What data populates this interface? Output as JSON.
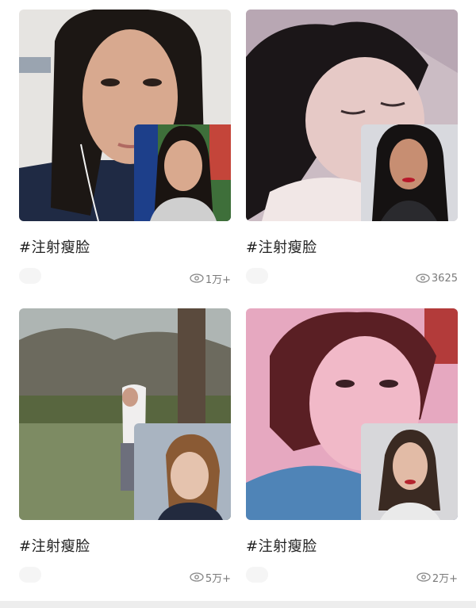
{
  "cards": [
    {
      "title": "#注射瘦脸",
      "views": "1万+"
    },
    {
      "title": "#注射瘦脸",
      "views": "3625"
    },
    {
      "title": "#注射瘦脸",
      "views": "5万+"
    },
    {
      "title": "#注射瘦脸",
      "views": "2万+"
    }
  ],
  "icons": {
    "view_count": "eye-icon"
  }
}
